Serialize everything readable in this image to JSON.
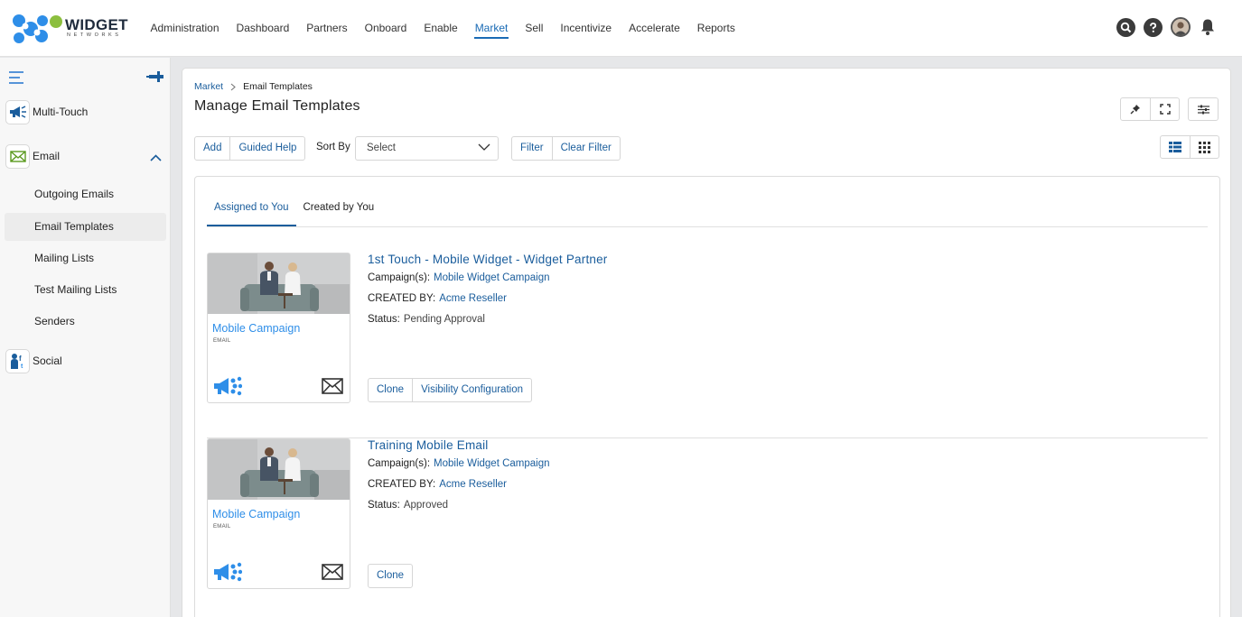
{
  "brand": {
    "name": "WIDGET",
    "sub": "NETWORKS",
    "accent": "#1a5d9c",
    "logo_blue": "#2e8ee8",
    "logo_green": "#8cbf3f"
  },
  "nav": {
    "items": [
      "Administration",
      "Dashboard",
      "Partners",
      "Onboard",
      "Enable",
      "Market",
      "Sell",
      "Incentivize",
      "Accelerate",
      "Reports"
    ],
    "active": "Market"
  },
  "top_icons": [
    "search-icon",
    "help-icon",
    "avatar",
    "bell-icon"
  ],
  "sidebar": {
    "top_items": [
      {
        "label": "Multi-Touch",
        "icon": "megaphone-icon"
      },
      {
        "label": "Email",
        "icon": "envelope-icon"
      },
      {
        "label": "Social",
        "icon": "social-icon"
      }
    ],
    "email_sub": [
      "Outgoing Emails",
      "Email Templates",
      "Mailing Lists",
      "Test Mailing Lists",
      "Senders"
    ],
    "active_sub": "Email Templates"
  },
  "breadcrumb": {
    "parent": "Market",
    "current": "Email Templates"
  },
  "page_title": "Manage Email Templates",
  "toolbar": {
    "add": "Add",
    "guided_help": "Guided Help",
    "sort_by": "Sort By",
    "sort_select": "Select",
    "filter": "Filter",
    "clear_filter": "Clear Filter"
  },
  "tabs": [
    "Assigned to You",
    "Created by You"
  ],
  "active_tab": "Assigned to You",
  "labels": {
    "campaigns": "Campaign(s):",
    "created_by": "CREATED BY:",
    "status": "Status:"
  },
  "templates": [
    {
      "thumb_title": "Mobile Campaign",
      "thumb_sub": "EMAIL",
      "title": "1st Touch - Mobile Widget - Widget Partner",
      "campaign": "Mobile Widget Campaign",
      "created_by": "Acme Reseller",
      "status": "Pending Approval",
      "actions": [
        "Clone",
        "Visibility Configuration"
      ]
    },
    {
      "thumb_title": "Mobile Campaign",
      "thumb_sub": "EMAIL",
      "title": "Training Mobile Email",
      "campaign": "Mobile Widget Campaign",
      "created_by": "Acme Reseller",
      "status": "Approved",
      "actions": [
        "Clone"
      ]
    }
  ]
}
